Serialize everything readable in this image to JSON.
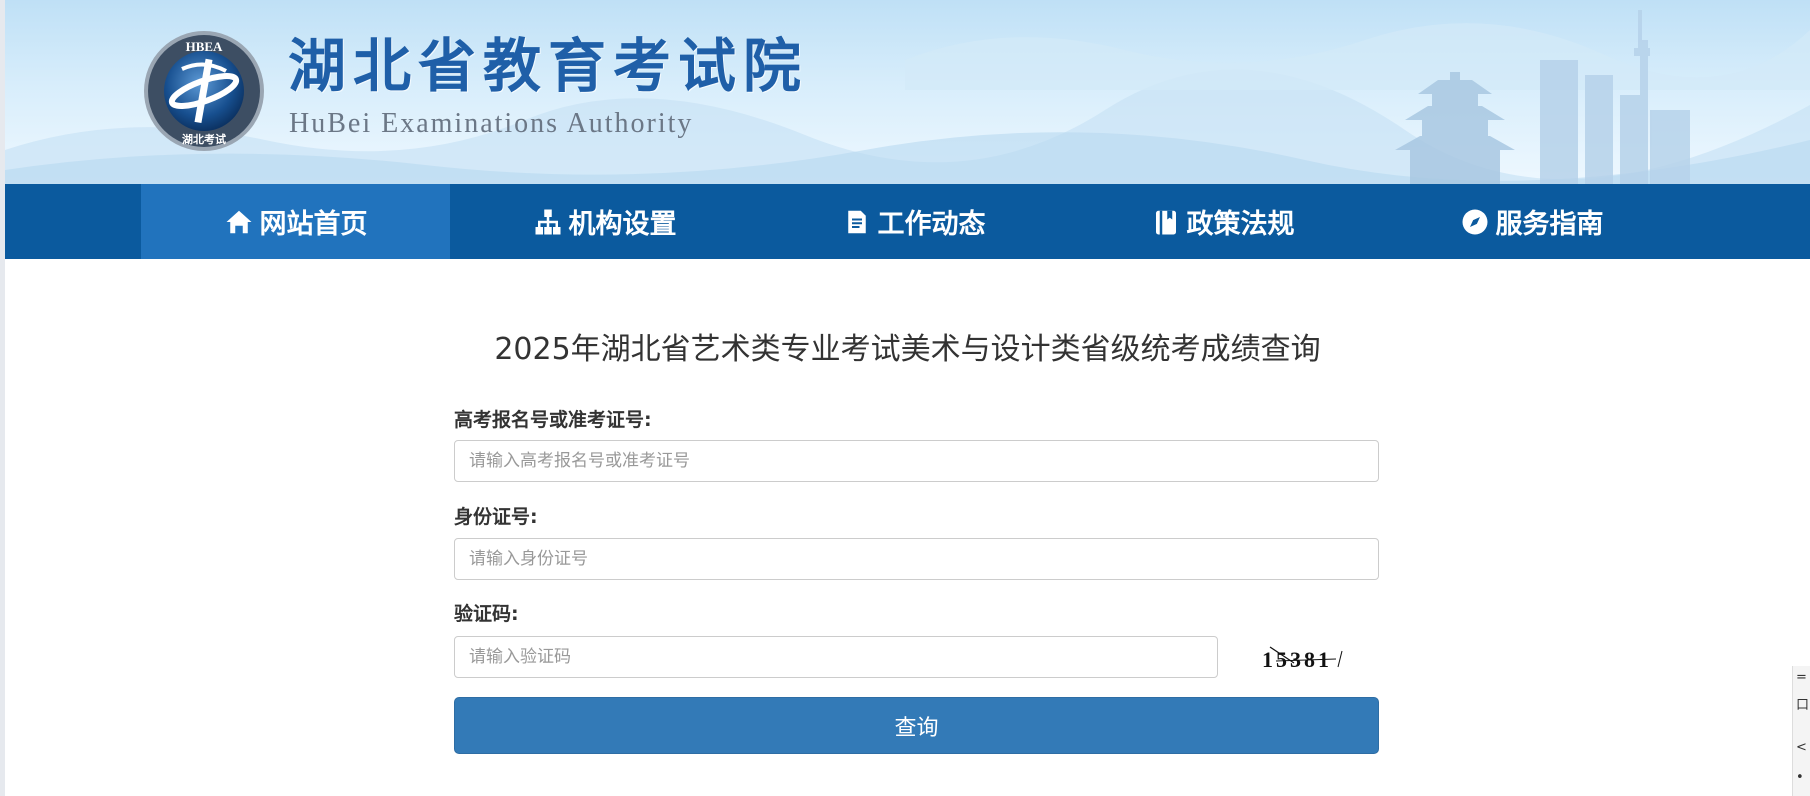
{
  "header": {
    "logo_ring_text": "HBEA",
    "logo_bottom_text": "湖北考试",
    "title": "湖北省教育考试院",
    "subtitle": "HuBei Examinations Authority"
  },
  "nav": {
    "items": [
      {
        "label": "网站首页",
        "icon": "home-icon",
        "active": true
      },
      {
        "label": "机构设置",
        "icon": "sitemap-icon",
        "active": false
      },
      {
        "label": "工作动态",
        "icon": "document-icon",
        "active": false
      },
      {
        "label": "政策法规",
        "icon": "book-icon",
        "active": false
      },
      {
        "label": "服务指南",
        "icon": "compass-icon",
        "active": false
      }
    ]
  },
  "form": {
    "title": "2025年湖北省艺术类专业考试美术与设计类省级统考成绩查询",
    "exam_number": {
      "label": "高考报名号或准考证号:",
      "placeholder": "请输入高考报名号或准考证号",
      "value": ""
    },
    "id_number": {
      "label": "身份证号:",
      "placeholder": "请输入身份证号",
      "value": ""
    },
    "captcha": {
      "label": "验证码:",
      "placeholder": "请输入验证码",
      "value": "",
      "image_text": "15381"
    },
    "submit_label": "查询"
  },
  "colors": {
    "nav_bg": "#0b5a9e",
    "nav_active": "#2173bd",
    "button": "#337ab7",
    "logo_title": "#1f5fa8"
  }
}
